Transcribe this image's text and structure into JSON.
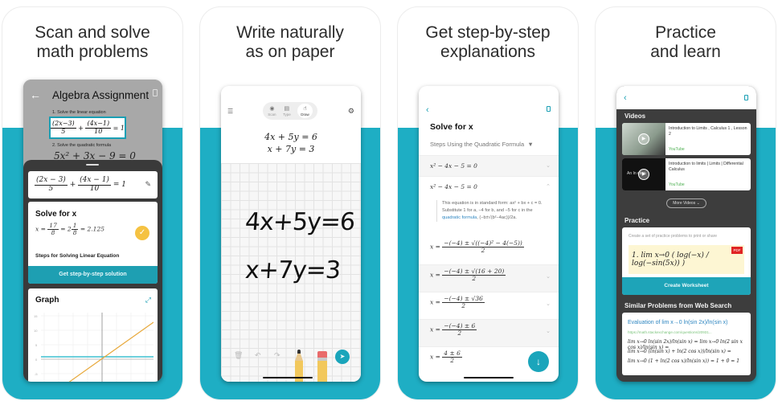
{
  "colors": {
    "accent": "#1eaec4",
    "button": "#1e9fb2",
    "check": "#f5c242",
    "pdf": "#e02424",
    "link": "#2e86c1"
  },
  "cards": [
    {
      "headline_1": "Scan and solve",
      "headline_2": "math problems",
      "scan": {
        "title": "Algebra Assignment",
        "q1": "1. Solve the linear equation",
        "q1_num1": "(2x−3)",
        "q1_den1": "5",
        "q1_num2": "(4x−1)",
        "q1_den2": "10",
        "q1_rhs": "= 1",
        "q2": "2. Solve the quadratic formula",
        "q2_eq": "5x² + 3x − 9 = 0"
      },
      "result_sheet": {
        "eq_num1": "(2x − 3)",
        "eq_den1": "5",
        "eq_plus": "+",
        "eq_num2": "(4x − 1)",
        "eq_den2": "10",
        "eq_rhs": "= 1",
        "solve_title": "Solve for x",
        "solve_lhs": "x =",
        "solve_num": "17",
        "solve_den": "8",
        "solve_mixed": "= 2",
        "solve_mixed_num": "1",
        "solve_mixed_den": "8",
        "solve_decimal": "= 2.125",
        "steps_label": "Steps for Solving Linear Equation",
        "steps_button": "Get step-by-step solution",
        "graph_title": "Graph",
        "graph_y_ticks": [
          "15",
          "10",
          "5",
          "0",
          "-5"
        ]
      }
    },
    {
      "headline_1": "Write naturally",
      "headline_2": "as on paper",
      "modes": [
        {
          "label": "Scan",
          "icon": "camera-icon"
        },
        {
          "label": "Type",
          "icon": "keyboard-icon"
        },
        {
          "label": "Draw",
          "icon": "hand-draw-icon"
        }
      ],
      "typed_1": "4x + 5y = 6",
      "typed_2": "x + 7y = 3",
      "handwritten_1": "4x+5y=6",
      "handwritten_2": "x+7y=3"
    },
    {
      "headline_1": "Get step-by-step",
      "headline_2": "explanations",
      "title": "Solve for x",
      "method": "Steps Using the Quadratic Formula",
      "method_arrow": "▼",
      "eq_1": "x² − 4x − 5 = 0",
      "eq_2": "x² − 4x − 5 = 0",
      "explain_a": "This equation is in standard form: ax² + bx + c = 0. Substitute 1 for a, −4 for b, and −5 for c in the ",
      "explain_link": "quadratic formula",
      "explain_b": ", (−b±√(b²−4ac))/2a.",
      "steps": [
        {
          "num": "−(−4) ± √((−4)² − 4(−5))",
          "den": "2"
        },
        {
          "num": "−(−4) ± √(16 + 20)",
          "den": "2"
        },
        {
          "num": "−(−4) ± √36",
          "den": "2"
        },
        {
          "num": "−(−4) ± 6",
          "den": "2"
        },
        {
          "num": "4 ± 6",
          "den": "2"
        }
      ],
      "x_eq": "x ="
    },
    {
      "headline_1": "Practice",
      "headline_2": "and learn",
      "videos_title": "Videos",
      "videos": [
        {
          "title": "Introduction to Limits , Calculus 1 , Lesson 2",
          "source": "YouTube"
        },
        {
          "title": "Introduction to limits | Limits | Differential Calculus",
          "source": "YouTube",
          "thumb_text": "An In  ction"
        }
      ],
      "more_videos": "More Videos ⌄",
      "practice_title": "Practice",
      "practice_hint": "Create a set of practice problems to print or share",
      "practice_sample": "1. lim x→0 ( log(−x) / log(−sin(5x)) )",
      "pdf_label": "PDF",
      "create_worksheet": "Create Worksheet",
      "web_title": "Similar Problems from Web Search",
      "web_result_title": "Evaluation of lim x→0 ln(sin 2x)/ln(sin x)",
      "web_result_url": "https://math.stackexchange.com/questions/20931...",
      "web_line_1": "lim x→0 ln(sin 2x)/ln(sin x) = lim x→0 ln(2 sin x cos x)/ln(sin x) =",
      "web_line_2": "lim x→0 (ln(sin x) + ln(2 cos x))/ln(sin x) =",
      "web_line_3": "lim x→0 (1 + ln(2 cos x)/ln(sin x)) = 1 + 0 = 1"
    }
  ]
}
